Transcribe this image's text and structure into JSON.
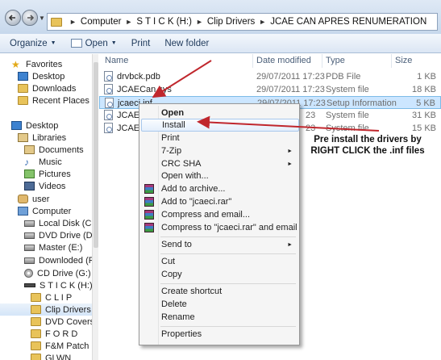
{
  "address": {
    "crumbs": [
      "Computer",
      "S T I C K (H:)",
      "Clip Drivers",
      "JCAE CAN APRES RENUMERATION"
    ]
  },
  "toolbar": {
    "organize": "Organize",
    "open": "Open",
    "print": "Print",
    "new_folder": "New folder"
  },
  "sidebar": {
    "favorites": "Favorites",
    "fav_items": [
      "Desktop",
      "Downloads",
      "Recent Places"
    ],
    "desktop": "Desktop",
    "libraries": "Libraries",
    "lib_items": [
      "Documents",
      "Music",
      "Pictures",
      "Videos"
    ],
    "user": "user",
    "computer": "Computer",
    "drives": [
      "Local Disk (C:)",
      "DVD Drive (D:)",
      "Master (E:)",
      "Downloded (F:)",
      "CD Drive (G:)",
      "S T I C K (H:)"
    ],
    "stick_folders": [
      "C L I P",
      "Clip Drivers",
      "DVD Covers",
      "F O R D",
      "F&M Patch",
      "GLWN"
    ]
  },
  "columns": {
    "name": "Name",
    "date": "Date modified",
    "type": "Type",
    "size": "Size"
  },
  "files": [
    {
      "name": "drvbck.pdb",
      "date": "29/07/2011 17:23",
      "type": "PDB File",
      "size": "1 KB"
    },
    {
      "name": "JCAECan.sys",
      "date": "29/07/2011 17:23",
      "type": "System file",
      "size": "18 KB"
    },
    {
      "name": "jcaeci.inf",
      "date": "29/07/2011 17:23",
      "type": "Setup Information",
      "size": "5 KB"
    },
    {
      "name": "JCAECI.",
      "date": "23",
      "type": "System file",
      "size": "31 KB"
    },
    {
      "name": "JCAEIso",
      "date": "23",
      "type": "System file",
      "size": "15 KB"
    }
  ],
  "context_menu": {
    "open": "Open",
    "install": "Install",
    "print": "Print",
    "zip": "7-Zip",
    "crc": "CRC SHA",
    "open_with": "Open with...",
    "add_archive": "Add to archive...",
    "add_rar": "Add to \"jcaeci.rar\"",
    "compress_email": "Compress and email...",
    "compress_rar_email": "Compress to \"jcaeci.rar\" and email",
    "send_to": "Send to",
    "cut": "Cut",
    "copy": "Copy",
    "create_shortcut": "Create shortcut",
    "delete": "Delete",
    "rename": "Rename",
    "properties": "Properties"
  },
  "annotation": {
    "line1": "Pre install the drivers by",
    "line2": "RIGHT CLICK the .inf files"
  },
  "colors": {
    "arrow": "#c0272d",
    "selection": "#cce6ff"
  }
}
